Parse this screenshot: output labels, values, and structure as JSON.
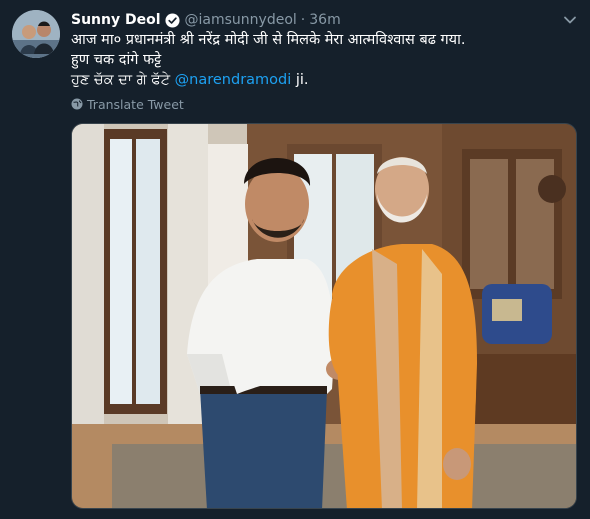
{
  "tweet": {
    "author_name": "Sunny Deol",
    "handle": "@iamsunnydeol",
    "separator": "·",
    "time": "36m",
    "line1": "आज मा० प्रधानमंत्री श्री नरेंद्र मोदी जी से मिलके मेरा आत्मविश्वास बढ गया.",
    "line2": "हुण चक दांगे फट्टे",
    "line3_text": "ਹੁਣ ਚੱਕ ਦਾ ਗੇ ਫੱਟੇ ",
    "mention": "@narendramodi",
    "line3_suffix": " ji.",
    "translate_label": "Translate Tweet"
  },
  "icons": {
    "verified": "verified-badge-icon",
    "caret": "chevron-down-icon",
    "translate": "globe-icon"
  },
  "colors": {
    "background": "#15202b",
    "text": "#ffffff",
    "secondary": "#8899a6",
    "link": "#1da1f2"
  }
}
